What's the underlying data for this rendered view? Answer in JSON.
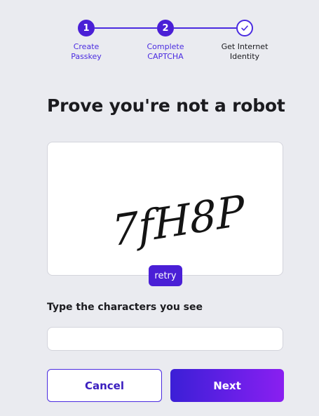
{
  "stepper": {
    "steps": [
      {
        "number": "1",
        "label_line1": "Create",
        "label_line2": "Passkey",
        "state": "complete"
      },
      {
        "number": "2",
        "label_line1": "Complete",
        "label_line2": "CAPTCHA",
        "state": "current"
      },
      {
        "number": "check-icon",
        "label_line1": "Get Internet",
        "label_line2": "Identity",
        "state": "upcoming"
      }
    ]
  },
  "main": {
    "title": "Prove you're not a robot",
    "captcha_text": "7fH8P",
    "retry_label": "retry",
    "input_label": "Type the characters you see",
    "input_value": "",
    "input_placeholder": ""
  },
  "actions": {
    "cancel_label": "Cancel",
    "next_label": "Next"
  },
  "colors": {
    "accent": "#4a1fd6",
    "background": "#eaebf0",
    "text": "#1b1b1f"
  }
}
